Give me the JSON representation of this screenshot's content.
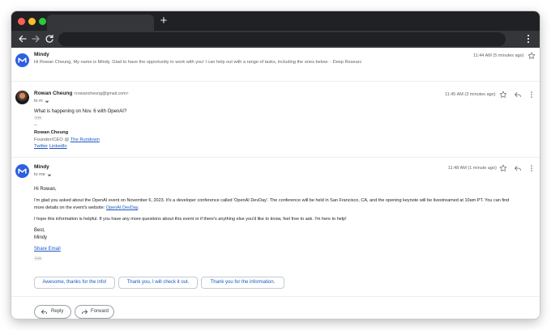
{
  "browser": {
    "new_tab_symbol": "+"
  },
  "thread": {
    "collapsed_message": {
      "sender": "Mindy",
      "snippet": "Hi Rowan Cheung, My name is Mindy. Glad to have the opportunity to work with you! I can help out with a range of tasks, including the ones below: - Deep Researc",
      "time": "11:44 AM (5 minutes ago)"
    },
    "message_1": {
      "sender_name": "Rowan Cheung",
      "sender_email": "<rowancheung@gmail.com>",
      "to": "to m",
      "time": "11:45 AM (3 minutes ago)",
      "body": "What is happening on Nov. 6 with OpenAI?",
      "sig_dashes": "--",
      "sig_name": "Rowan Cheung",
      "sig_title_prefix": "Founder/CEO @ ",
      "sig_title_link": "The Rundown",
      "sig_link_twitter": "Twitter",
      "sig_link_separator": " ",
      "sig_link_linkedin": "LinkedIn"
    },
    "message_2": {
      "sender": "Mindy",
      "to": "to me",
      "time": "11:48 AM (1 minute ago)",
      "greeting": "Hi Rowan,",
      "para1_line1": "I'm glad you asked about the OpenAI event on November 6, 2023. It's a developer conference called 'OpenAI DevDay'. The conference will be held in San Francisco, CA, and the opening keynote will be livestreamed at 10am PT. You can find",
      "para1_line2_prefix": "more details on the event's website: ",
      "para1_link": "OpenAI DevDay",
      "para1_suffix": ".",
      "para2": "I hope this information is helpful. If you have any more questions about this event or if there's anything else you'd like to know, feel free to ask. I'm here to help!",
      "closing": "Best,",
      "closing_name": "Mindy",
      "share_link": "Share Email"
    },
    "smart_replies": [
      "Awesome, thanks for the info!",
      "Thank you, I will check it out.",
      "Thank you for the information."
    ],
    "actions": {
      "reply": "Reply",
      "forward": "Forward"
    }
  },
  "colors": {
    "accent_blue": "#1a57c4",
    "avatar_blue": "#2d5fe0",
    "titlebar": "#202124"
  }
}
